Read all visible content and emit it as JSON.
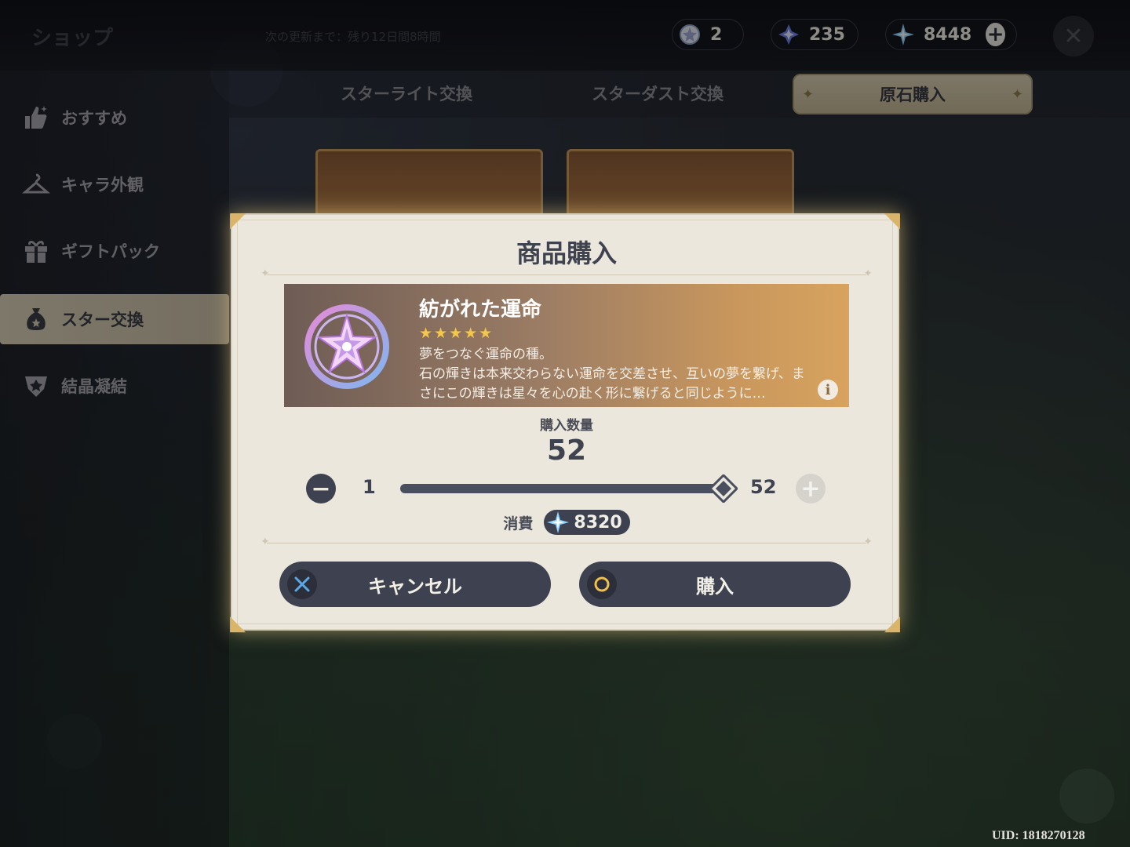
{
  "header": {
    "shop_title": "ショップ",
    "shop_note": "次の更新まで：残り12日間8時間",
    "currencies": [
      {
        "icon": "fate-icon",
        "value": "2"
      },
      {
        "icon": "stardust-icon",
        "value": "235"
      },
      {
        "icon": "primogem-icon",
        "value": "8448"
      }
    ]
  },
  "sidebar": {
    "items": [
      {
        "label": "おすすめ",
        "icon": "thumbs-up-icon"
      },
      {
        "label": "キャラ外観",
        "icon": "hanger-icon"
      },
      {
        "label": "ギフトパック",
        "icon": "gift-icon"
      },
      {
        "label": "スター交換",
        "icon": "money-bag-icon"
      },
      {
        "label": "結晶凝結",
        "icon": "crystal-emblem-icon"
      }
    ],
    "active_index": 3
  },
  "tabs": [
    {
      "label": "スターライト交換"
    },
    {
      "label": "スターダスト交換"
    },
    {
      "label": "原石購入"
    }
  ],
  "dialog": {
    "title": "商品購入",
    "item": {
      "name": "紡がれた運命",
      "rarity": 5,
      "stars": "★★★★★",
      "description": "夢をつなぐ運命の種。\n石の輝きは本来交わらない運命を交差させ、互いの夢を繋げ、まさにこの輝きは星々を心の赴く形に繋げると同じように…"
    },
    "quantity_label": "購入数量",
    "quantity": "52",
    "quantity_fraction": 1.0,
    "min": "1",
    "max": "52",
    "cost_label": "消費",
    "cost_value": "8320",
    "cancel_label": "キャンセル",
    "buy_label": "購入"
  },
  "uid": "UID: 1818270128",
  "colors": {
    "dialog_bg": "#ece7dd",
    "button_bg": "#3e4250",
    "star_gold": "#f3c74a",
    "accent_gold": "#d9b46a"
  }
}
